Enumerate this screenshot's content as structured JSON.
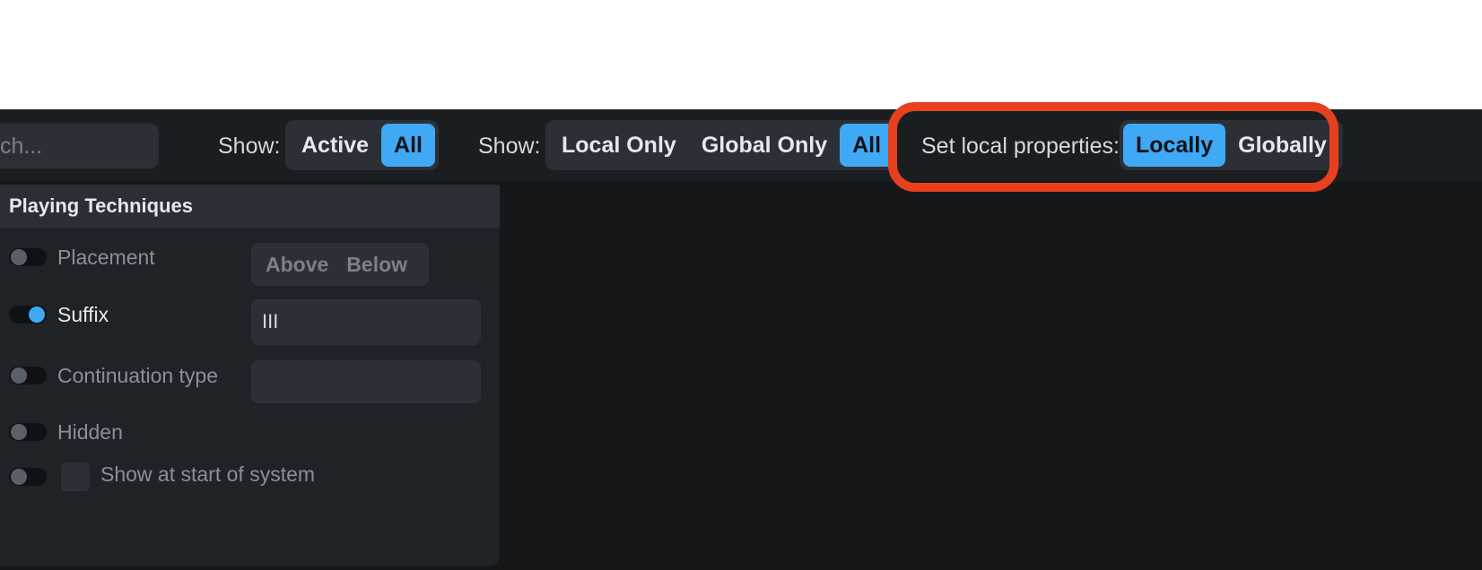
{
  "toolbar": {
    "search_placeholder": "ch...",
    "filter1": {
      "label": "Show:",
      "options": [
        "Active",
        "All"
      ],
      "selected": "All"
    },
    "filter2": {
      "label": "Show:",
      "options": [
        "Local Only",
        "Global Only",
        "All"
      ],
      "selected": "All"
    },
    "local_props": {
      "label": "Set local properties:",
      "options": [
        "Locally",
        "Globally"
      ],
      "selected": "Locally"
    }
  },
  "panel": {
    "title": "Playing Techniques",
    "rows": [
      {
        "label": "Placement",
        "enabled": false
      },
      {
        "label": "Suffix",
        "enabled": true
      },
      {
        "label": "Continuation type",
        "enabled": false
      },
      {
        "label": "Hidden",
        "enabled": false
      },
      {
        "label": "Show at start of system",
        "enabled": false
      }
    ],
    "placement_options": [
      "Above",
      "Below"
    ],
    "suffix_value": "III",
    "continuation_value": ""
  },
  "colors": {
    "accent": "#3fa9f5",
    "highlight": "#e8401f",
    "background": "#151719"
  }
}
